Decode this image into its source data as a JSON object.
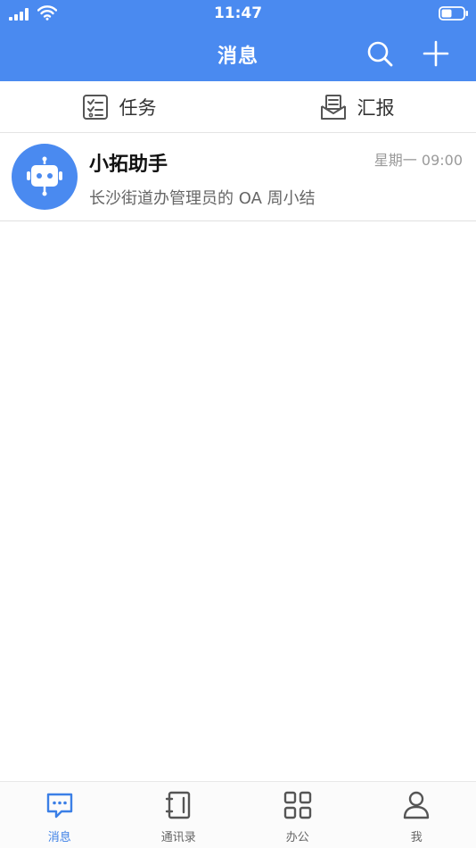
{
  "status_bar": {
    "time": "11:47",
    "icons": [
      "signal-icon",
      "wifi-icon",
      "battery-icon"
    ]
  },
  "nav": {
    "title": "消息",
    "actions": [
      "search-icon",
      "plus-icon"
    ]
  },
  "shortcuts": [
    {
      "label": "任务",
      "icon": "checklist-icon"
    },
    {
      "label": "汇报",
      "icon": "report-icon"
    }
  ],
  "messages": [
    {
      "title": "小拓助手",
      "time": "星期一 09:00",
      "preview": "长沙街道办管理员的 OA 周小结",
      "avatar_icon": "robot-icon"
    }
  ],
  "tabs": [
    {
      "label": "消息",
      "icon": "chat-icon",
      "active": true
    },
    {
      "label": "通讯录",
      "icon": "contacts-book-icon",
      "active": false
    },
    {
      "label": "办公",
      "icon": "apps-grid-icon",
      "active": false
    },
    {
      "label": "我",
      "icon": "person-icon",
      "active": false
    }
  ],
  "colors": {
    "brand": "#4a8af0",
    "tab_active": "#3b7fe6",
    "icon_gray": "#555555",
    "time_gray": "#9a9a9a"
  }
}
